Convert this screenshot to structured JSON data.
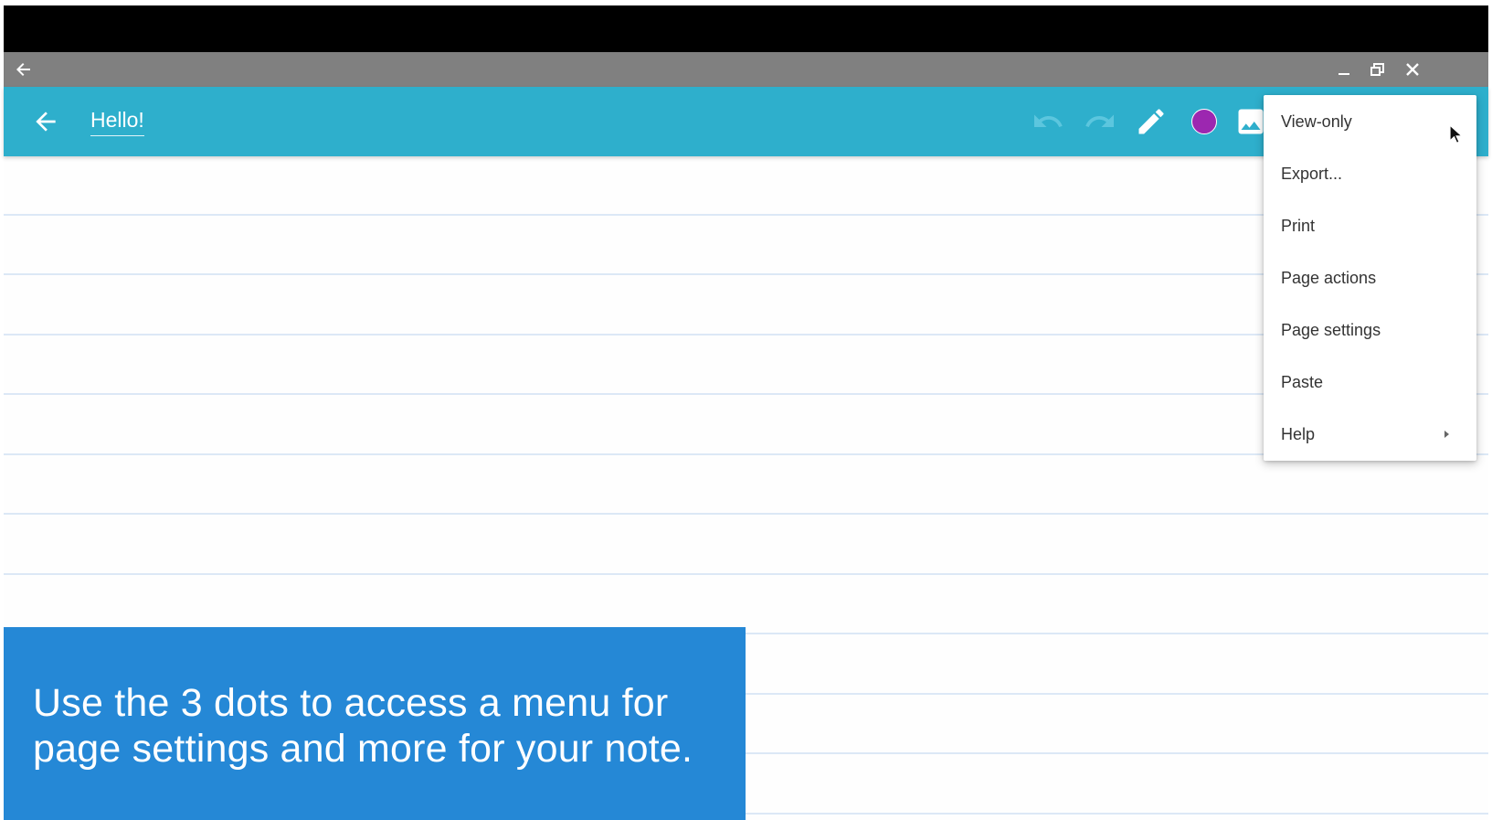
{
  "window": {
    "controls": [
      "back-icon",
      "minimize-icon",
      "restore-icon",
      "close-icon"
    ]
  },
  "appbar": {
    "title": "Hello!",
    "background_color": "#2eafcc",
    "tools": [
      "undo-icon",
      "redo-icon",
      "pen-icon",
      "color-picker-icon",
      "image-icon"
    ],
    "selected_color": "#9c27b0"
  },
  "menu": {
    "items": [
      {
        "label": "View-only"
      },
      {
        "label": "Export..."
      },
      {
        "label": "Print"
      },
      {
        "label": "Page actions"
      },
      {
        "label": "Page settings"
      },
      {
        "label": "Paste"
      },
      {
        "label": "Help",
        "has_submenu": true
      }
    ]
  },
  "caption": {
    "line1": "Use the 3 dots to access a menu for",
    "line2": "page settings and more for your note.",
    "background_color": "#2588d6"
  }
}
